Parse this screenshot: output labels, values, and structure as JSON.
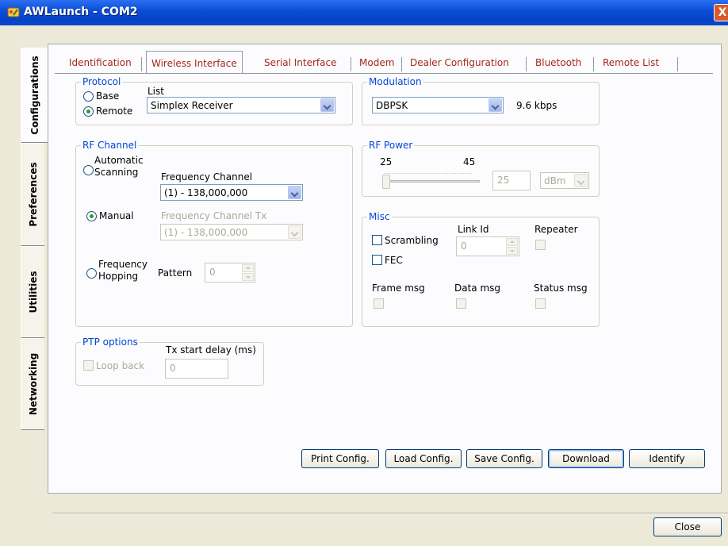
{
  "window": {
    "title": "AWLaunch - COM2",
    "close_glyph": "X"
  },
  "vertical_tabs": [
    "Configurations",
    "Preferences",
    "Utilities",
    "Networking"
  ],
  "tabs": [
    "Identification",
    "Wireless Interface",
    "Serial Interface",
    "Modem",
    "Dealer Configuration",
    "Bluetooth",
    "Remote List"
  ],
  "protocol": {
    "legend": "Protocol",
    "base_label": "Base",
    "remote_label": "Remote",
    "list_label": "List",
    "list_value": "Simplex Receiver"
  },
  "modulation": {
    "legend": "Modulation",
    "value": "DBPSK",
    "rate": "9.6 kbps"
  },
  "rf_channel": {
    "legend": "RF Channel",
    "automatic_label_1": "Automatic",
    "automatic_label_2": "Scanning",
    "freq_channel_label": "Frequency Channel",
    "freq_channel_value": "(1) - 138,000,000",
    "manual_label": "Manual",
    "freq_channel_tx_label": "Frequency Channel Tx",
    "freq_channel_tx_value": "(1) - 138,000,000",
    "hopping_label_1": "Frequency",
    "hopping_label_2": "Hopping",
    "pattern_label": "Pattern",
    "pattern_value": "0"
  },
  "rf_power": {
    "legend": "RF Power",
    "min_label": "25",
    "max_label": "45",
    "value": "25",
    "level": 0,
    "unit": "dBm"
  },
  "misc": {
    "legend": "Misc",
    "scrambling_label": "Scrambling",
    "fec_label": "FEC",
    "link_id_label": "Link Id",
    "link_id_value": "0",
    "repeater_label": "Repeater",
    "frame_msg_label": "Frame msg",
    "data_msg_label": "Data msg",
    "status_msg_label": "Status msg"
  },
  "ptp": {
    "legend": "PTP options",
    "loop_back_label": "Loop back",
    "tx_delay_label": "Tx start delay (ms)",
    "tx_delay_value": "0"
  },
  "buttons": {
    "print": "Print Config.",
    "load": "Load Config.",
    "save": "Save Config.",
    "download": "Download",
    "identify": "Identify",
    "close": "Close"
  },
  "colors": {
    "title_bar": "#0b4fd8",
    "tab_text": "#a5281b",
    "legend": "#0046d5",
    "radio_dot": "#21a121"
  }
}
